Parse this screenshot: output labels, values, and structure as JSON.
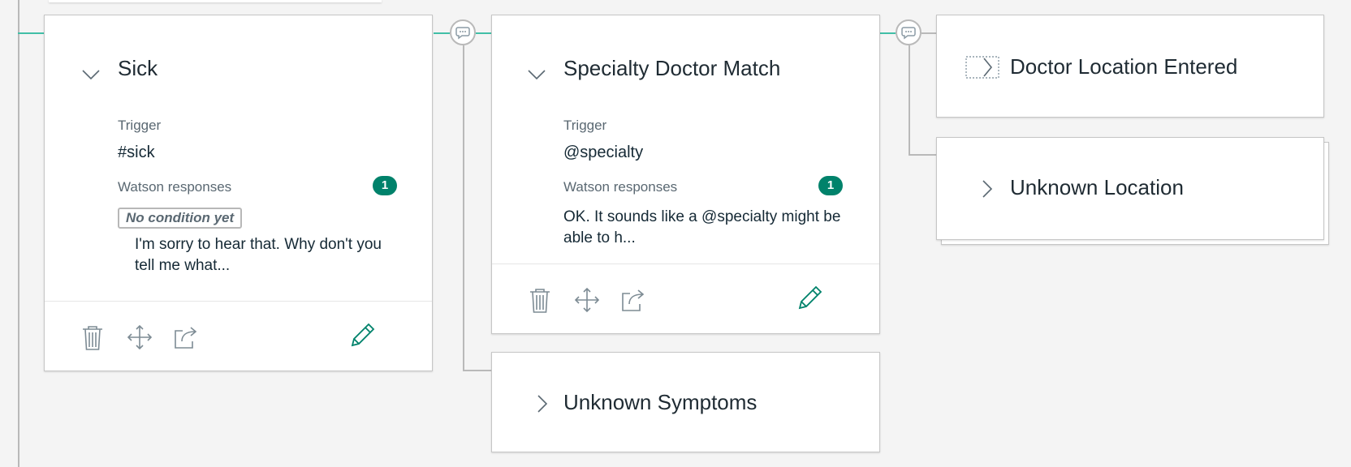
{
  "nodes": {
    "sick": {
      "title": "Sick",
      "trigger_label": "Trigger",
      "trigger_value": "#sick",
      "responses_label": "Watson responses",
      "responses_count": "1",
      "condition_tag": "No condition yet",
      "response_text": "I'm sorry to hear that. Why don't you tell me what..."
    },
    "specialty": {
      "title": "Specialty Doctor Match",
      "trigger_label": "Trigger",
      "trigger_value": "@specialty",
      "responses_label": "Watson responses",
      "responses_count": "1",
      "response_text": "OK. It sounds like a @specialty might be able to h..."
    },
    "unknown_symptoms": {
      "title": "Unknown Symptoms"
    },
    "doctor_location": {
      "title": "Doctor Location Entered"
    },
    "unknown_location": {
      "title": "Unknown Location"
    }
  },
  "icons": [
    "trash-icon",
    "move-icon",
    "jump-to-icon",
    "edit-icon",
    "chevron-down-icon",
    "chevron-right-icon",
    "speech-bubble-icon"
  ],
  "colors": {
    "accent": "#00826b",
    "connector": "#41bfa7"
  }
}
